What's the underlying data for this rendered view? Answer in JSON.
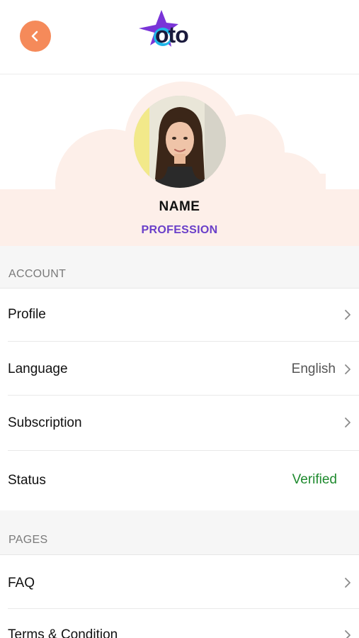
{
  "header": {
    "back_icon": "chevron-left-icon",
    "logo_text": "oto",
    "accent_color": "#f58a5a"
  },
  "profile": {
    "name": "NAME",
    "profession": "PROFESSION",
    "profession_color": "#6a3fc9",
    "hero_bg_color": "#fdefe9"
  },
  "sections": [
    {
      "title": "ACCOUNT",
      "items": [
        {
          "label": "Profile",
          "value": ""
        },
        {
          "label": "Language",
          "value": "English"
        },
        {
          "label": "Subscription",
          "value": ""
        },
        {
          "label": "Status",
          "value": "Verified",
          "value_color": "#1e8a2e"
        }
      ]
    },
    {
      "title": "PAGES",
      "items": [
        {
          "label": "FAQ",
          "value": ""
        },
        {
          "label": "Terms & Condition",
          "value": ""
        }
      ]
    }
  ]
}
